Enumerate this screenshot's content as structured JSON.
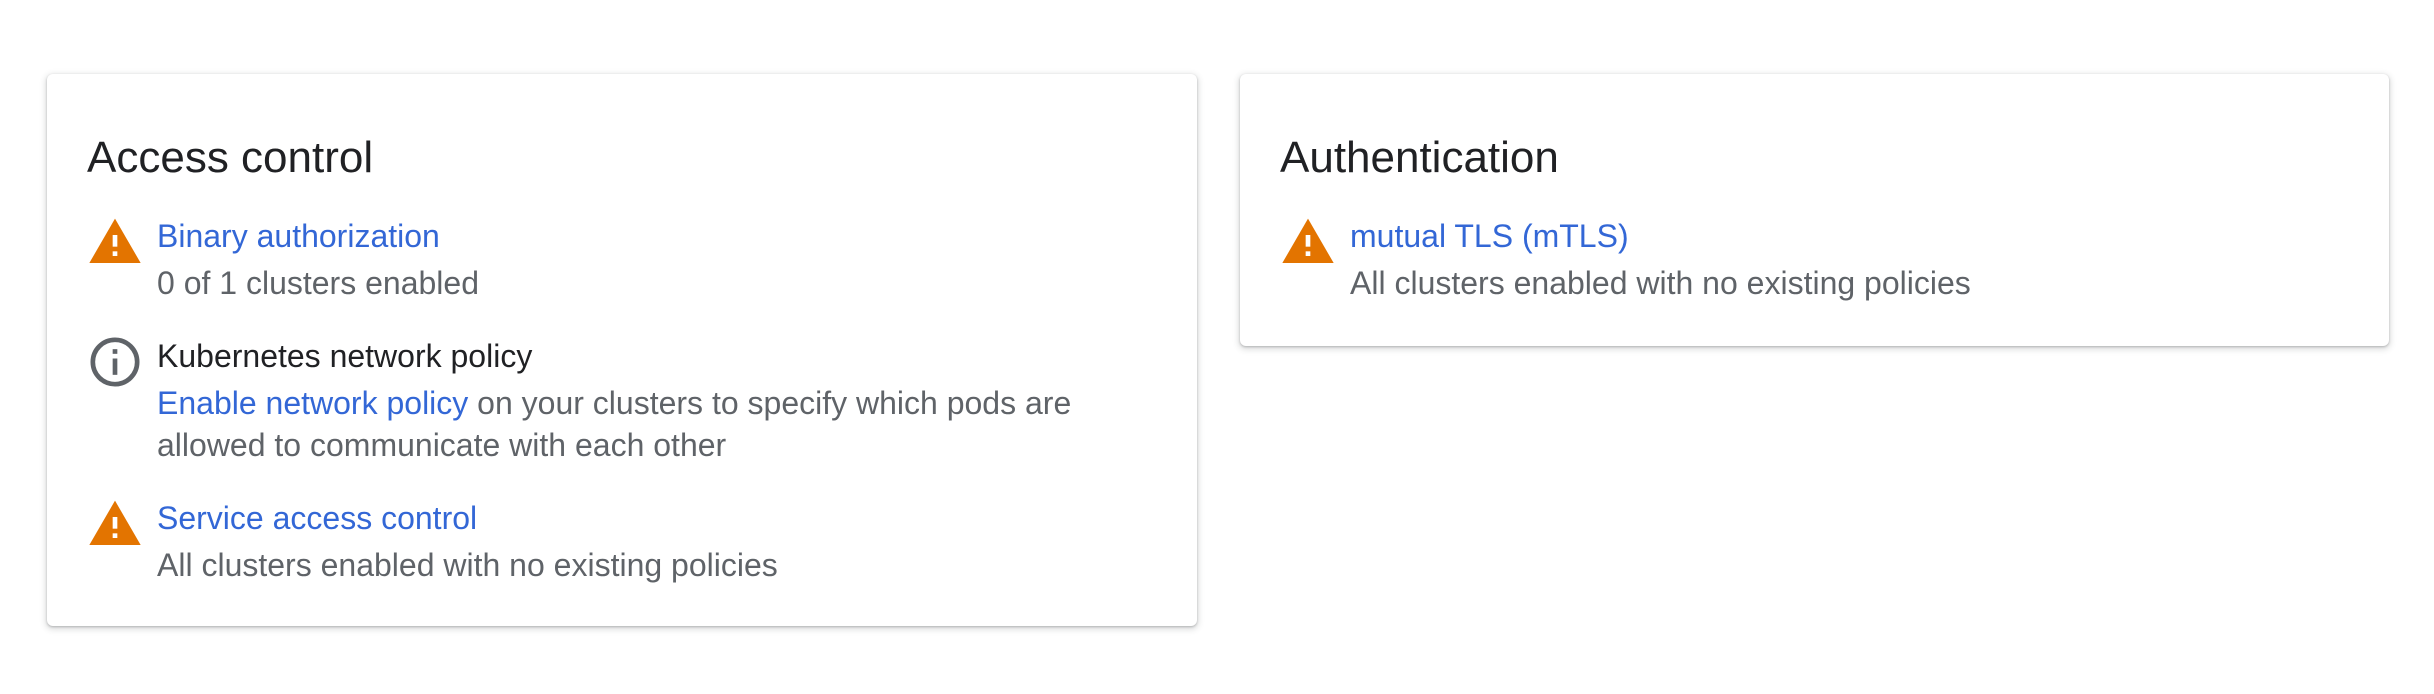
{
  "colors": {
    "warning": "#E37400",
    "info": "#5f6368",
    "link": "#3367d6"
  },
  "access_control": {
    "title": "Access control",
    "items": [
      {
        "icon": "warning-icon",
        "title": "Binary authorization",
        "desc": "0 of 1 clusters enabled"
      },
      {
        "icon": "info-icon",
        "title": "Kubernetes network policy",
        "link": "Enable network policy",
        "desc_rest": " on your clusters to specify which pods are allowed to communicate with each other"
      },
      {
        "icon": "warning-icon",
        "title": "Service access control",
        "desc": "All clusters enabled with no existing policies"
      }
    ]
  },
  "authentication": {
    "title": "Authentication",
    "items": [
      {
        "icon": "warning-icon",
        "title": "mutual TLS (mTLS)",
        "desc": "All clusters enabled with no existing policies"
      }
    ]
  }
}
